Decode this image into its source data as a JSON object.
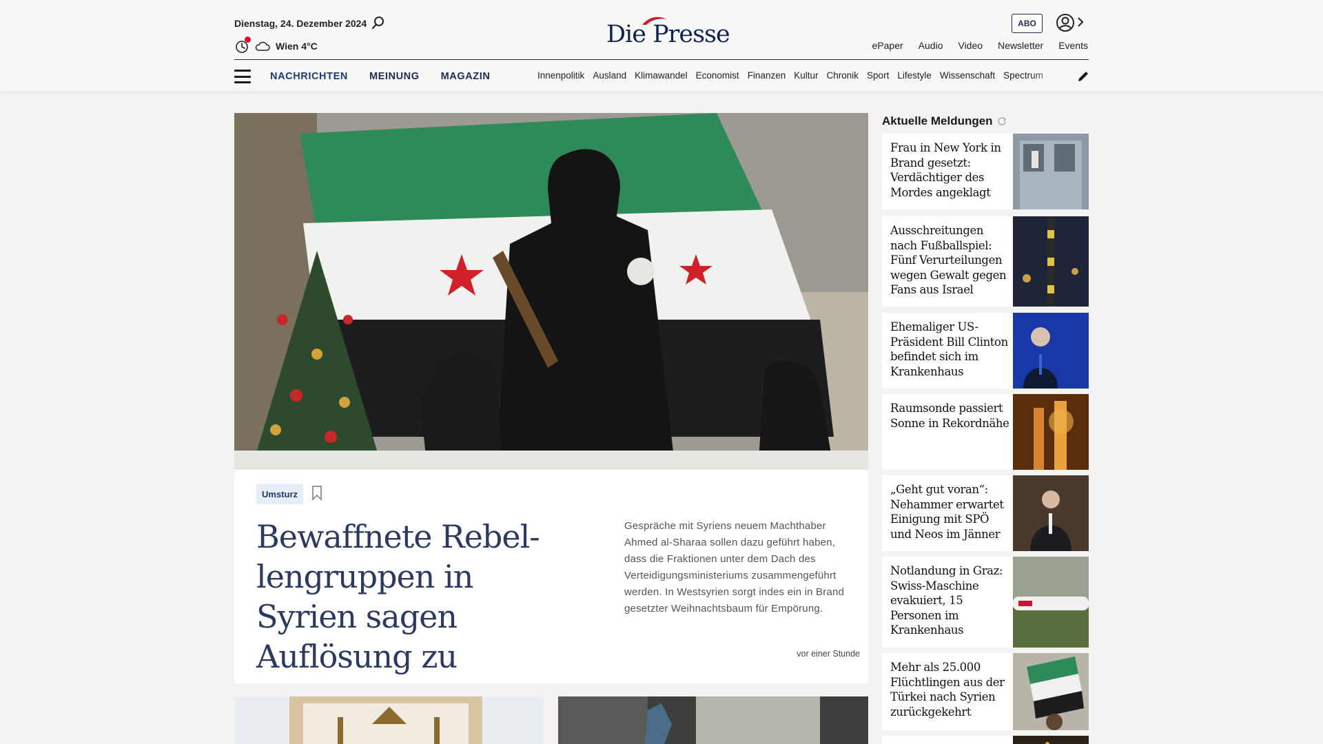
{
  "header": {
    "date": "Dienstag, 24. Dezember 2024",
    "weather": "Wien 4°C",
    "logo": "Die Presse",
    "abo_label": "ABO",
    "top_links": [
      "ePaper",
      "Audio",
      "Video",
      "Newsletter",
      "Events"
    ]
  },
  "nav": {
    "main": [
      "NACHRICHTEN",
      "MEINUNG",
      "MAGAZIN"
    ],
    "sub": [
      "Innenpolitik",
      "Ausland",
      "Klimawandel",
      "Economist",
      "Finanzen",
      "Kultur",
      "Chronik",
      "Sport",
      "Lifestyle",
      "Wissenschaft",
      "Spectrum"
    ]
  },
  "hero": {
    "tag": "Umsturz",
    "title": "Bewaffnete Rebel­lengruppen in Syrien sagen Auflösung zu",
    "teaser": "Gespräche mit Syriens neuem Machthaber Ahmed al-Sharaa sollen dazu geführt haben, dass die Fraktionen unter dem Dach des Verteidigungsministeriums zusammengeführt werden. In Westsyrien sorgt indes ein in Brand gesetzter Weihnachtsbaum für Empörung.",
    "time": "vor einer Stunde"
  },
  "sidebar": {
    "title": "Aktuelle Meldungen",
    "items": [
      {
        "text": "Frau in New York in Brand gesetzt: Verdächtiger des Mordes angeklagt"
      },
      {
        "text": "Ausschreitungen nach Fußballspiel: Fünf Verurteilungen wegen Gewalt gegen Fans aus Israel"
      },
      {
        "text": "Ehemaliger US-Präsident Bill Clinton befindet sich im Krankenhaus"
      },
      {
        "text": "Raumsonde passiert Sonne in Rekordnähe"
      },
      {
        "text": "„Geht gut voran“: Nehammer erwartet Einigung mit SPÖ und Neos im Jänner"
      },
      {
        "text": "Notlandung in Graz: Swiss-Maschine evakuiert, 15 Personen im Krankenhaus"
      },
      {
        "text": "Mehr als 25.000 Flüchtlingen aus der Türkei nach Syrien zurückgekehrt"
      }
    ]
  },
  "colors": {
    "brand_navy": "#1d2c4f",
    "brand_red": "#d0132e",
    "headline_blue": "#2b3a5e",
    "background": "#f3f3f1"
  }
}
